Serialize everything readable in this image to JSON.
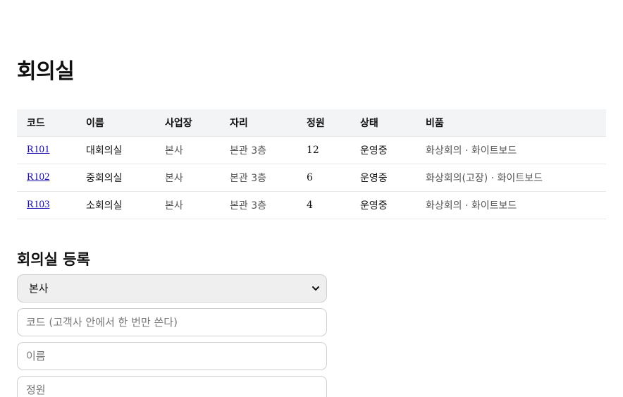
{
  "page": {
    "title": "회의실"
  },
  "table": {
    "headers": [
      "코드",
      "이름",
      "사업장",
      "자리",
      "정원",
      "상태",
      "비품"
    ],
    "rows": [
      {
        "code": "R101",
        "name": "대회의실",
        "site": "본사",
        "seat": "본관 3층",
        "capacity": "12",
        "status": "운영중",
        "equipment": "화상회의 · 화이트보드"
      },
      {
        "code": "R102",
        "name": "중회의실",
        "site": "본사",
        "seat": "본관 3층",
        "capacity": "6",
        "status": "운영중",
        "equipment": "화상회의(고장) · 화이트보드"
      },
      {
        "code": "R103",
        "name": "소회의실",
        "site": "본사",
        "seat": "본관 3층",
        "capacity": "4",
        "status": "운영중",
        "equipment": "화상회의 · 화이트보드"
      }
    ]
  },
  "form": {
    "title": "회의실 등록",
    "site_select_value": "본사",
    "code_placeholder": "코드 (고객사 안에서 한 번만 쓴다)",
    "name_placeholder": "이름",
    "capacity_placeholder": "정원"
  },
  "icons": {
    "select_arrow": "chevron-down-icon"
  },
  "colors": {
    "link": "#1a0dab",
    "header_bg": "#f3f4f6",
    "select_bg": "#efefef"
  }
}
